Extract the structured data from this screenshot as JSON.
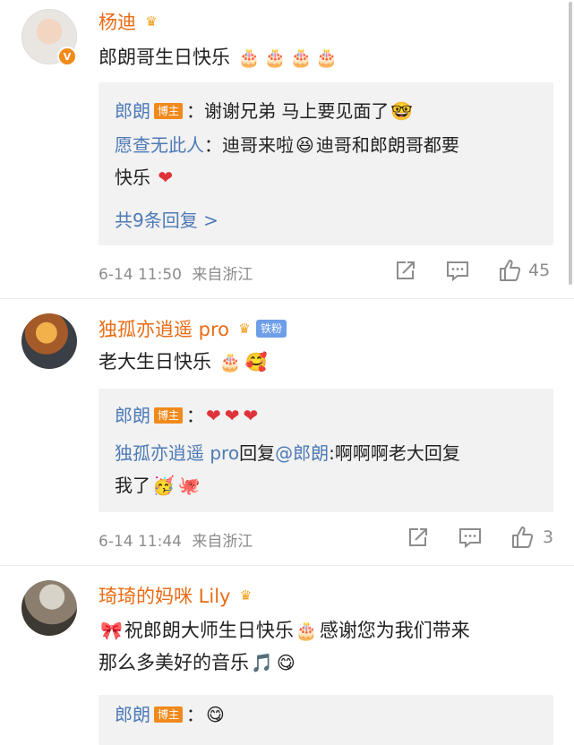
{
  "comments": [
    {
      "username": "杨迪",
      "text": "郎朗哥生日快乐",
      "replies": [
        {
          "name": "郎朗",
          "badge": "博主",
          "text": "：谢谢兄弟 马上要见面了"
        },
        {
          "name": "愿查无此人",
          "text": "：迪哥来啦"
        },
        {
          "text_a": "迪哥和郎朗哥都要",
          "text_b": "快乐"
        }
      ],
      "more": "共9条回复 >",
      "time": "6-14 11:50",
      "source": "来自浙江",
      "likes": "45"
    },
    {
      "username": "独孤亦逍遥 pro",
      "fan_badge": "铁粉",
      "text": "老大生日快乐",
      "replies": [
        {
          "name": "郎朗",
          "badge": "博主",
          "text": "："
        },
        {
          "name": "独孤亦逍遥 pro",
          "mid": "回复",
          "at": "@郎朗",
          "text": ":啊啊啊老大回复",
          "text2": "我了"
        }
      ],
      "time": "6-14 11:44",
      "source": "来自浙江",
      "likes": "3"
    },
    {
      "username": "琦琦的妈咪 Lily",
      "text_a": "祝郎朗大师生日快乐",
      "text_b": "感谢您为我们带来",
      "text_c": "那么多美好的音乐",
      "replies": [
        {
          "name": "郎朗",
          "badge": "博主",
          "text": "："
        }
      ]
    }
  ],
  "icons": {
    "verified": "V",
    "crown": "♛",
    "cake": "🎂",
    "heart": "❤"
  },
  "colors": {
    "username": "#e96b13",
    "reply_name": "#4d7ab6",
    "badge": "#f08a1c",
    "meta": "#8c8c8c"
  }
}
